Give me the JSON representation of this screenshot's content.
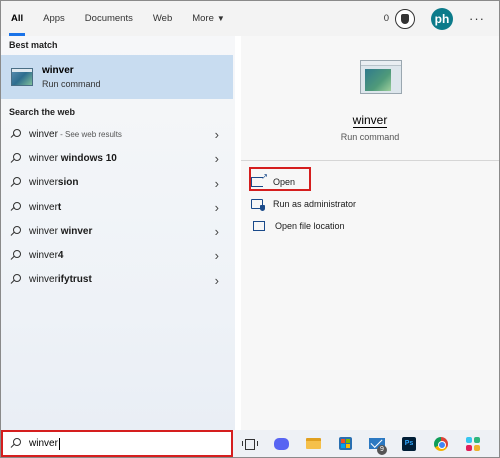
{
  "tabs": {
    "items": [
      {
        "label": "All",
        "active": true
      },
      {
        "label": "Apps",
        "active": false
      },
      {
        "label": "Documents",
        "active": false
      },
      {
        "label": "Web",
        "active": false
      },
      {
        "label": "More",
        "active": false
      }
    ],
    "points": "0",
    "avatar_initials": "ph",
    "more_options_glyph": "···"
  },
  "best_match": {
    "section_title": "Best match",
    "name": "winver",
    "type": "Run command"
  },
  "search_web": {
    "section_title": "Search the web",
    "items": [
      {
        "plain": "winver",
        "bold": "",
        "hint": " - See web results"
      },
      {
        "plain": "winver ",
        "bold": "windows 10",
        "hint": ""
      },
      {
        "plain": "winver",
        "bold": "sion",
        "hint": ""
      },
      {
        "plain": "winver",
        "bold": "t",
        "hint": ""
      },
      {
        "plain": "winver ",
        "bold": "winver",
        "hint": ""
      },
      {
        "plain": "winver",
        "bold": "4",
        "hint": ""
      },
      {
        "plain": "winver",
        "bold": "ifytrust",
        "hint": ""
      }
    ]
  },
  "detail": {
    "name": "winver",
    "type": "Run command",
    "actions": [
      {
        "label": "Open",
        "icon": "open-icon"
      },
      {
        "label": "Run as administrator",
        "icon": "admin-shield-icon"
      },
      {
        "label": "Open file location",
        "icon": "file-location-icon"
      }
    ]
  },
  "search": {
    "query": "winver",
    "icon": "search-icon"
  },
  "taskbar": {
    "items": [
      "task-view-icon",
      "discord-icon",
      "file-explorer-icon",
      "microsoft-store-icon",
      "mail-icon",
      "photoshop-icon",
      "chrome-icon",
      "slack-icon"
    ],
    "mail_badge": "9",
    "photoshop_label": "Ps"
  },
  "colors": {
    "accent": "#1a73e8",
    "selection": "#c8dcf0",
    "highlight_box": "#d51e1e"
  }
}
